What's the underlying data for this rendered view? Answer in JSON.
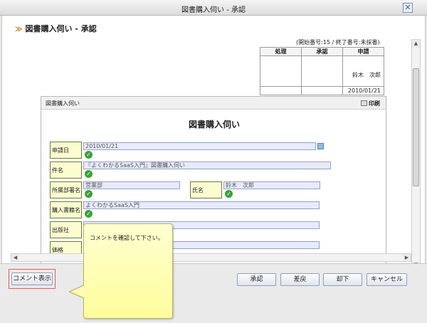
{
  "window": {
    "title": "図書購入伺い - 承認",
    "close_glyph": "✕"
  },
  "page": {
    "title": "図書購入伺い - 承認"
  },
  "info": {
    "text": "(開始番号:15 / 終了番号:未採番)"
  },
  "approval": {
    "headers": [
      "処理",
      "承認",
      "申請"
    ],
    "applicant": "鈴木　次郎",
    "date": "2010/01/21"
  },
  "panel": {
    "title": "図書購入伺い",
    "print_label": "印刷"
  },
  "form": {
    "title": "図書購入伺い",
    "fields": {
      "apply_date": {
        "label": "申請日",
        "value": "2010/01/21"
      },
      "subject": {
        "label": "件名",
        "value": "『よくわかるSaaS入門』図書購入伺い"
      },
      "department": {
        "label": "所属部署名",
        "value": "営業部"
      },
      "name": {
        "label": "氏名",
        "value": "鈴木　次郎"
      },
      "book": {
        "label": "購入書籍名",
        "value": "よくわかるSaaS入門"
      },
      "publisher": {
        "label": "出版社",
        "value": ""
      },
      "price": {
        "label": "価格",
        "value": ""
      }
    }
  },
  "buttons": {
    "comment": "コメント表示",
    "approve": "承認",
    "return": "差戻",
    "reject": "却下",
    "cancel": "キャンセル"
  },
  "note": {
    "text": "コメントを確認して下さい。"
  },
  "colors": {
    "label_bg": "#fbfdd0",
    "input_bg": "#e7ebfb",
    "check": "#3aa336",
    "note_bg": "#fdfd9c"
  }
}
